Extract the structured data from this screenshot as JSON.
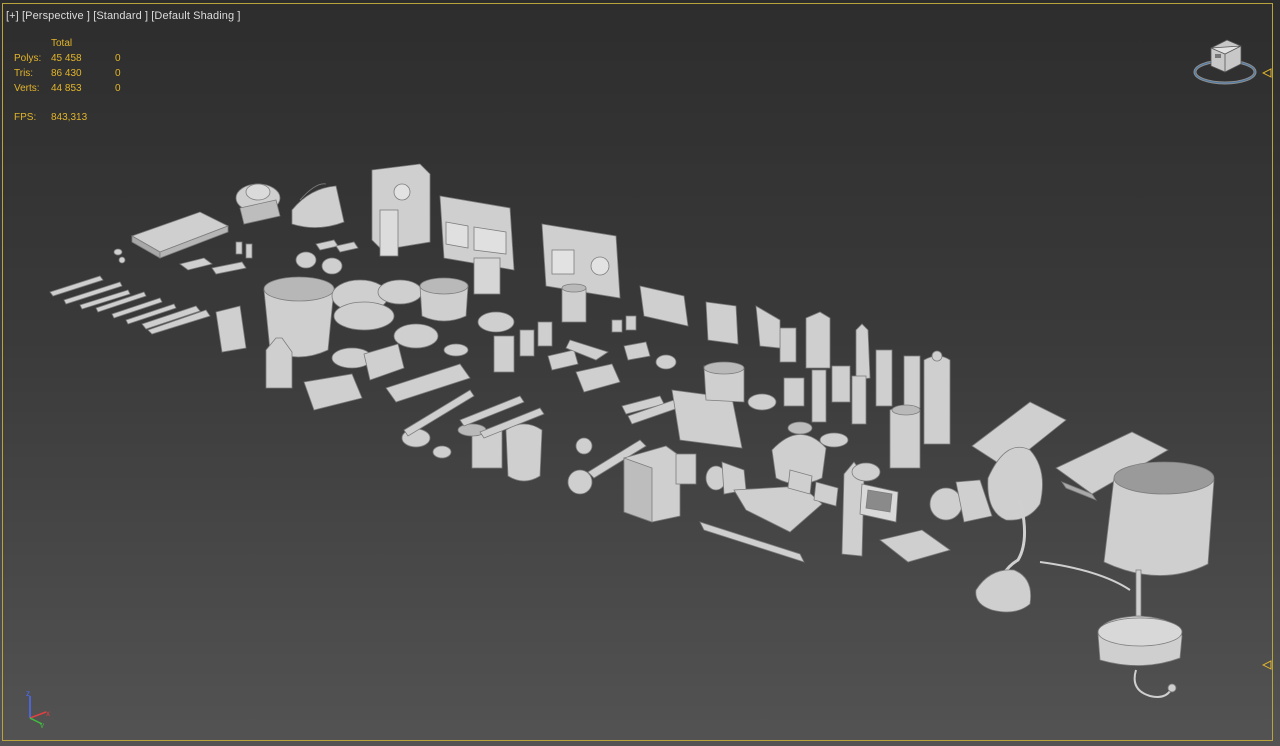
{
  "viewport": {
    "menus": [
      {
        "name": "viewport-menu-plus",
        "label": "[+]"
      },
      {
        "name": "viewport-menu-perspective",
        "label": "[Perspective ]"
      },
      {
        "name": "viewport-menu-standard",
        "label": "[Standard ]"
      },
      {
        "name": "viewport-menu-shading",
        "label": "[Default Shading ]"
      }
    ]
  },
  "stats": {
    "header": "Total",
    "rows": [
      {
        "label": "Polys:",
        "total": "45 458",
        "selected": "0"
      },
      {
        "label": "Tris:",
        "total": "86 430",
        "selected": "0"
      },
      {
        "label": "Verts:",
        "total": "44 853",
        "selected": "0"
      }
    ],
    "fps": {
      "label": "FPS:",
      "value": "843,313"
    }
  },
  "gizmo": {
    "axes": [
      "x",
      "y",
      "z"
    ]
  },
  "colors": {
    "frame": "#b9a33c",
    "stats_text": "#e3b52a",
    "label_text": "#dcdcdc",
    "model_fill": "#cfcfcf",
    "model_shadow": "#8c8c8c",
    "axis_x": "#e04040",
    "axis_y": "#40c040",
    "axis_z": "#4a6cff"
  }
}
